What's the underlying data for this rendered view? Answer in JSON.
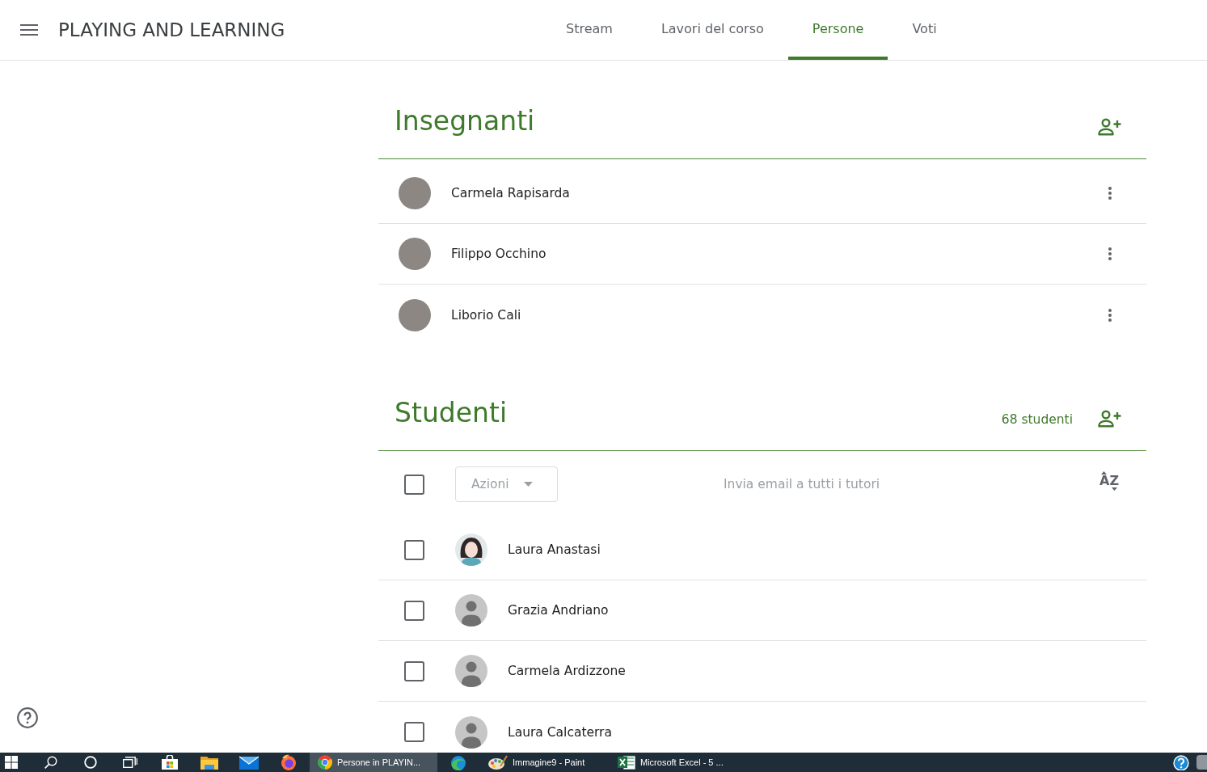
{
  "header": {
    "title": "PLAYING AND LEARNING"
  },
  "tabs": [
    {
      "label": "Stream",
      "selected": false
    },
    {
      "label": "Lavori del corso",
      "selected": false
    },
    {
      "label": "Persone",
      "selected": true
    },
    {
      "label": "Voti",
      "selected": false
    }
  ],
  "teachers": {
    "heading": "Insegnanti",
    "people": [
      {
        "name": "Carmela Rapisarda",
        "avatar": {
          "kind": "photo"
        }
      },
      {
        "name": "Filippo Occhino",
        "avatar": {
          "kind": "photo"
        }
      },
      {
        "name": "Liborio Cali",
        "avatar": {
          "kind": "photo"
        }
      }
    ]
  },
  "students": {
    "heading": "Studenti",
    "count": "68 studenti",
    "select_all": {
      "checked": false
    },
    "actions": {
      "label": "Azioni",
      "disabled": true
    },
    "email_link": {
      "label": "Invia email a tutti i tutori",
      "disabled": true
    },
    "sort": {
      "label": "AZ"
    },
    "people": [
      {
        "name": "Laura Anastasi",
        "avatar": {
          "kind": "illustration"
        },
        "checked": false
      },
      {
        "name": "Grazia Andriano",
        "avatar": {
          "kind": "default"
        },
        "checked": false
      },
      {
        "name": "Carmela Ardizzone",
        "avatar": {
          "kind": "default"
        },
        "checked": false
      },
      {
        "name": "Laura Calcaterra",
        "avatar": {
          "kind": "default"
        },
        "checked": false
      }
    ]
  },
  "taskbar": {
    "tasks": [
      {
        "label": "Persone in PLAYIN...",
        "selected": true
      },
      {
        "label": "Immagine9 - Paint",
        "selected": false
      },
      {
        "label": "Microsoft Excel - 5 ...",
        "selected": false
      }
    ]
  }
}
